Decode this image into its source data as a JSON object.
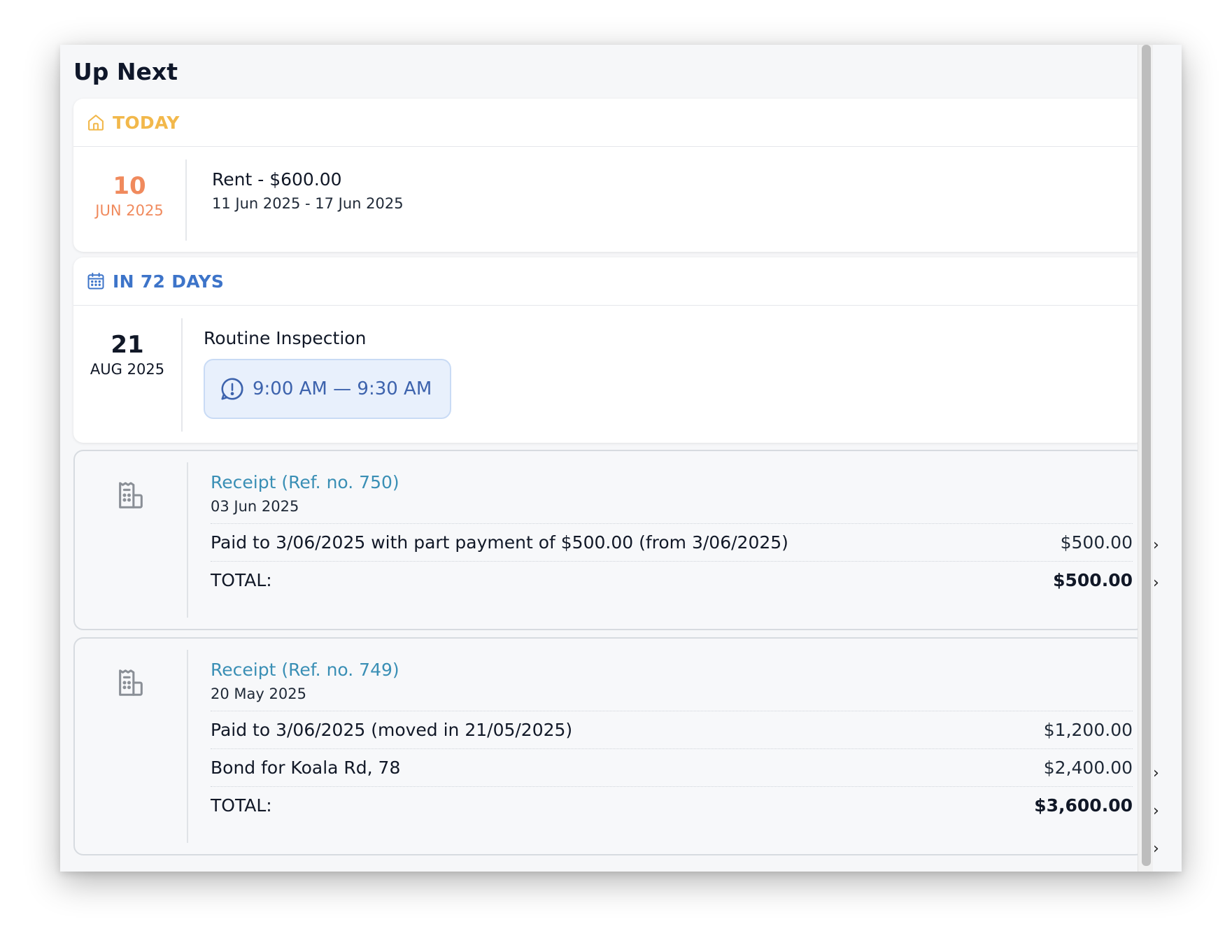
{
  "page_title": "Up Next",
  "colors": {
    "today_accent": "#f2b84b",
    "today_date": "#f08a5d",
    "upcoming_accent": "#3d74c9",
    "pill_text": "#3d63ad",
    "receipt_link": "#3a8fb5"
  },
  "today_card": {
    "icon": "home-icon",
    "heading": "TODAY",
    "day": "10",
    "month_year": "JUN 2025",
    "title": "Rent - $600.00",
    "subtitle": "11 Jun 2025 - 17 Jun 2025"
  },
  "upcoming_card": {
    "icon": "calendar-icon",
    "heading": "IN 72 DAYS",
    "day": "21",
    "month_year": "AUG 2025",
    "title": "Routine Inspection",
    "time_icon": "alert-clock-icon",
    "time_range": "9:00 AM — 9:30 AM"
  },
  "receipts": [
    {
      "icon": "receipt-icon",
      "title": "Receipt (Ref. no. 750)",
      "date": "03 Jun 2025",
      "lines": [
        {
          "label": "Paid to 3/06/2025 with part payment of $500.00 (from 3/06/2025)",
          "amount": "$500.00"
        }
      ],
      "total_label": "TOTAL:",
      "total_amount": "$500.00"
    },
    {
      "icon": "receipt-icon",
      "title": "Receipt (Ref. no. 749)",
      "date": "20 May 2025",
      "lines": [
        {
          "label": "Paid to 3/06/2025 (moved in 21/05/2025)",
          "amount": "$1,200.00"
        },
        {
          "label": "Bond for Koala Rd, 78",
          "amount": "$2,400.00"
        }
      ],
      "total_label": "TOTAL:",
      "total_amount": "$3,600.00"
    }
  ]
}
